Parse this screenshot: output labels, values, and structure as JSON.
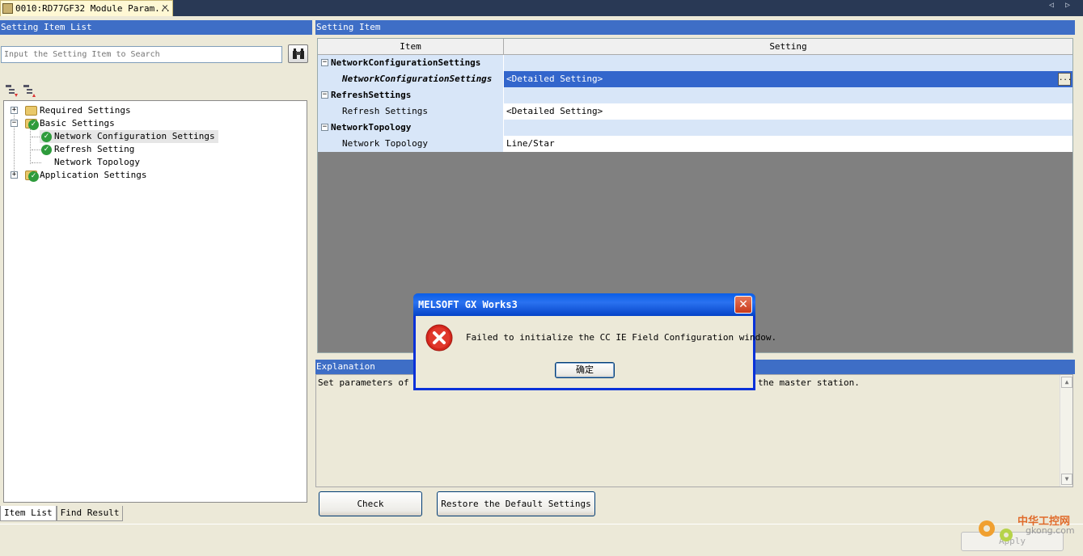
{
  "doc_tab": {
    "title": "0010:RD77GF32 Module Param...",
    "close": "✕"
  },
  "tab_nav": "◁ ▷",
  "left_panel": {
    "title": "Setting Item List",
    "search_placeholder": "Input the Setting Item to Search",
    "tree": [
      {
        "label": "Required Settings",
        "expander": "+"
      },
      {
        "label": "Basic Settings",
        "expander": "−"
      },
      {
        "label": "Network Configuration Settings"
      },
      {
        "label": "Refresh Setting"
      },
      {
        "label": "Network Topology"
      },
      {
        "label": "Application Settings",
        "expander": "+"
      }
    ],
    "bottom_tabs": [
      "Item List",
      "Find Result"
    ]
  },
  "right_panel": {
    "title": "Setting Item",
    "columns": [
      "Item",
      "Setting"
    ],
    "rows": [
      {
        "item": "NetworkConfigurationSettings",
        "setting": ""
      },
      {
        "item": "NetworkConfigurationSettings",
        "setting": "<Detailed Setting>",
        "button": "..."
      },
      {
        "item": "RefreshSettings",
        "setting": ""
      },
      {
        "item": "Refresh Settings",
        "setting": "<Detailed Setting>"
      },
      {
        "item": "NetworkTopology",
        "setting": ""
      },
      {
        "item": "Network Topology",
        "setting": "Line/Star"
      }
    ],
    "explanation_title": "Explanation",
    "explanation_left": "Set parameters of sl",
    "explanation_right": "the master station.",
    "check_label": "Check",
    "restore_label": "Restore the Default Settings"
  },
  "apply_label": "Apply",
  "watermark": {
    "cn": "中华工控网",
    "url": "gkong.com"
  },
  "dialog": {
    "title": "MELSOFT GX Works3",
    "message": "Failed to initialize the CC IE Field Configuration window.",
    "ok_label": "确定",
    "close": "✕"
  },
  "colors": {
    "title_blue": "#3e6ec6",
    "highlight": "#3366cc",
    "error_red": "#d4261c",
    "ok_green": "#2e9b3c"
  }
}
